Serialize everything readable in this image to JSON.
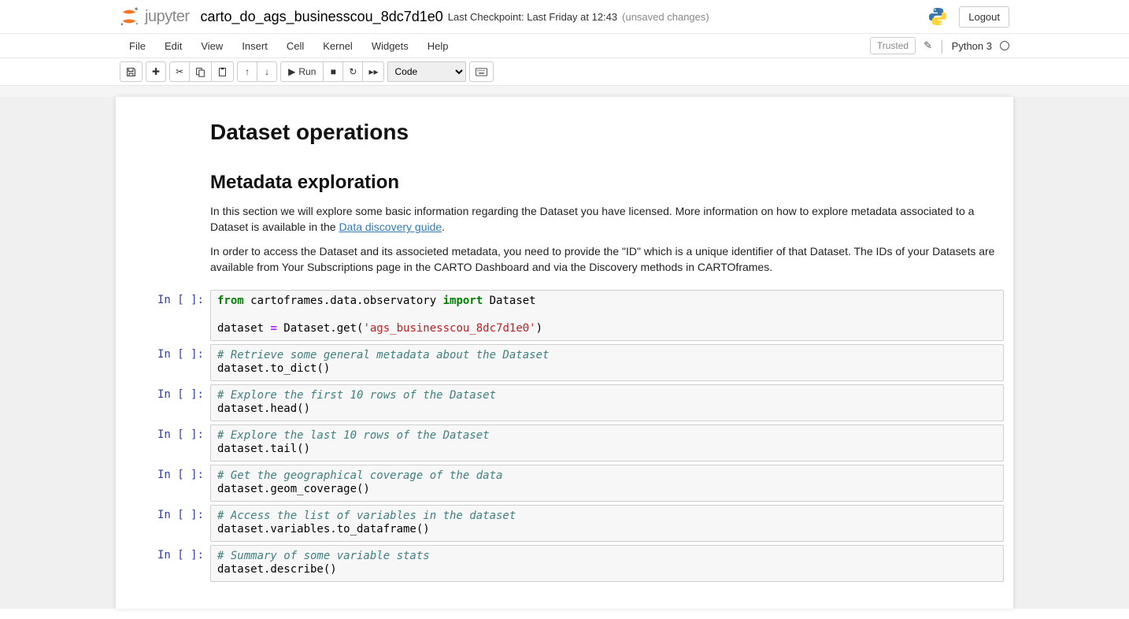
{
  "header": {
    "logo_text": "jupyter",
    "notebook_name": "carto_do_ags_businesscou_8dc7d1e0",
    "checkpoint": "Last Checkpoint: Last Friday at 12:43",
    "unsaved": "(unsaved changes)",
    "logout": "Logout"
  },
  "menubar": {
    "items": [
      "File",
      "Edit",
      "View",
      "Insert",
      "Cell",
      "Kernel",
      "Widgets",
      "Help"
    ],
    "trusted": "Trusted",
    "kernel_name": "Python 3"
  },
  "toolbar": {
    "run_label": "Run",
    "celltype_selected": "Code"
  },
  "markdown": {
    "h1": "Dataset operations",
    "h2": "Metadata exploration",
    "p1a": "In this section we will explore some basic information regarding the Dataset you have licensed. More information on how to explore metadata associated to a Dataset is available in the ",
    "p1_link": "Data discovery guide",
    "p1b": ".",
    "p2": "In order to access the Dataset and its associeted metadata, you need to provide the \"ID\" which is a unique identifier of that Dataset. The IDs of your Datasets are available from Your Subscriptions page in the CARTO Dashboard and via the Discovery methods in CARTOframes."
  },
  "prompts": {
    "in_empty": "In [ ]:"
  },
  "cells": {
    "c1": {
      "kw_from": "from",
      "mod": " cartoframes.data.observatory ",
      "kw_import": "import",
      "cls": " Dataset",
      "l3a": "dataset ",
      "op_eq": "=",
      "l3b": " Dataset.get(",
      "str": "'ags_businesscou_8dc7d1e0'",
      "l3c": ")"
    },
    "c2": {
      "comment": "# Retrieve some general metadata about the Dataset",
      "code": "dataset.to_dict()"
    },
    "c3": {
      "comment": "# Explore the first 10 rows of the Dataset",
      "code": "dataset.head()"
    },
    "c4": {
      "comment": "# Explore the last 10 rows of the Dataset",
      "code": "dataset.tail()"
    },
    "c5": {
      "comment": "# Get the geographical coverage of the data",
      "code": "dataset.geom_coverage()"
    },
    "c6": {
      "comment": "# Access the list of variables in the dataset",
      "code": "dataset.variables.to_dataframe()"
    },
    "c7": {
      "comment": "# Summary of some variable stats",
      "code": "dataset.describe()"
    }
  }
}
